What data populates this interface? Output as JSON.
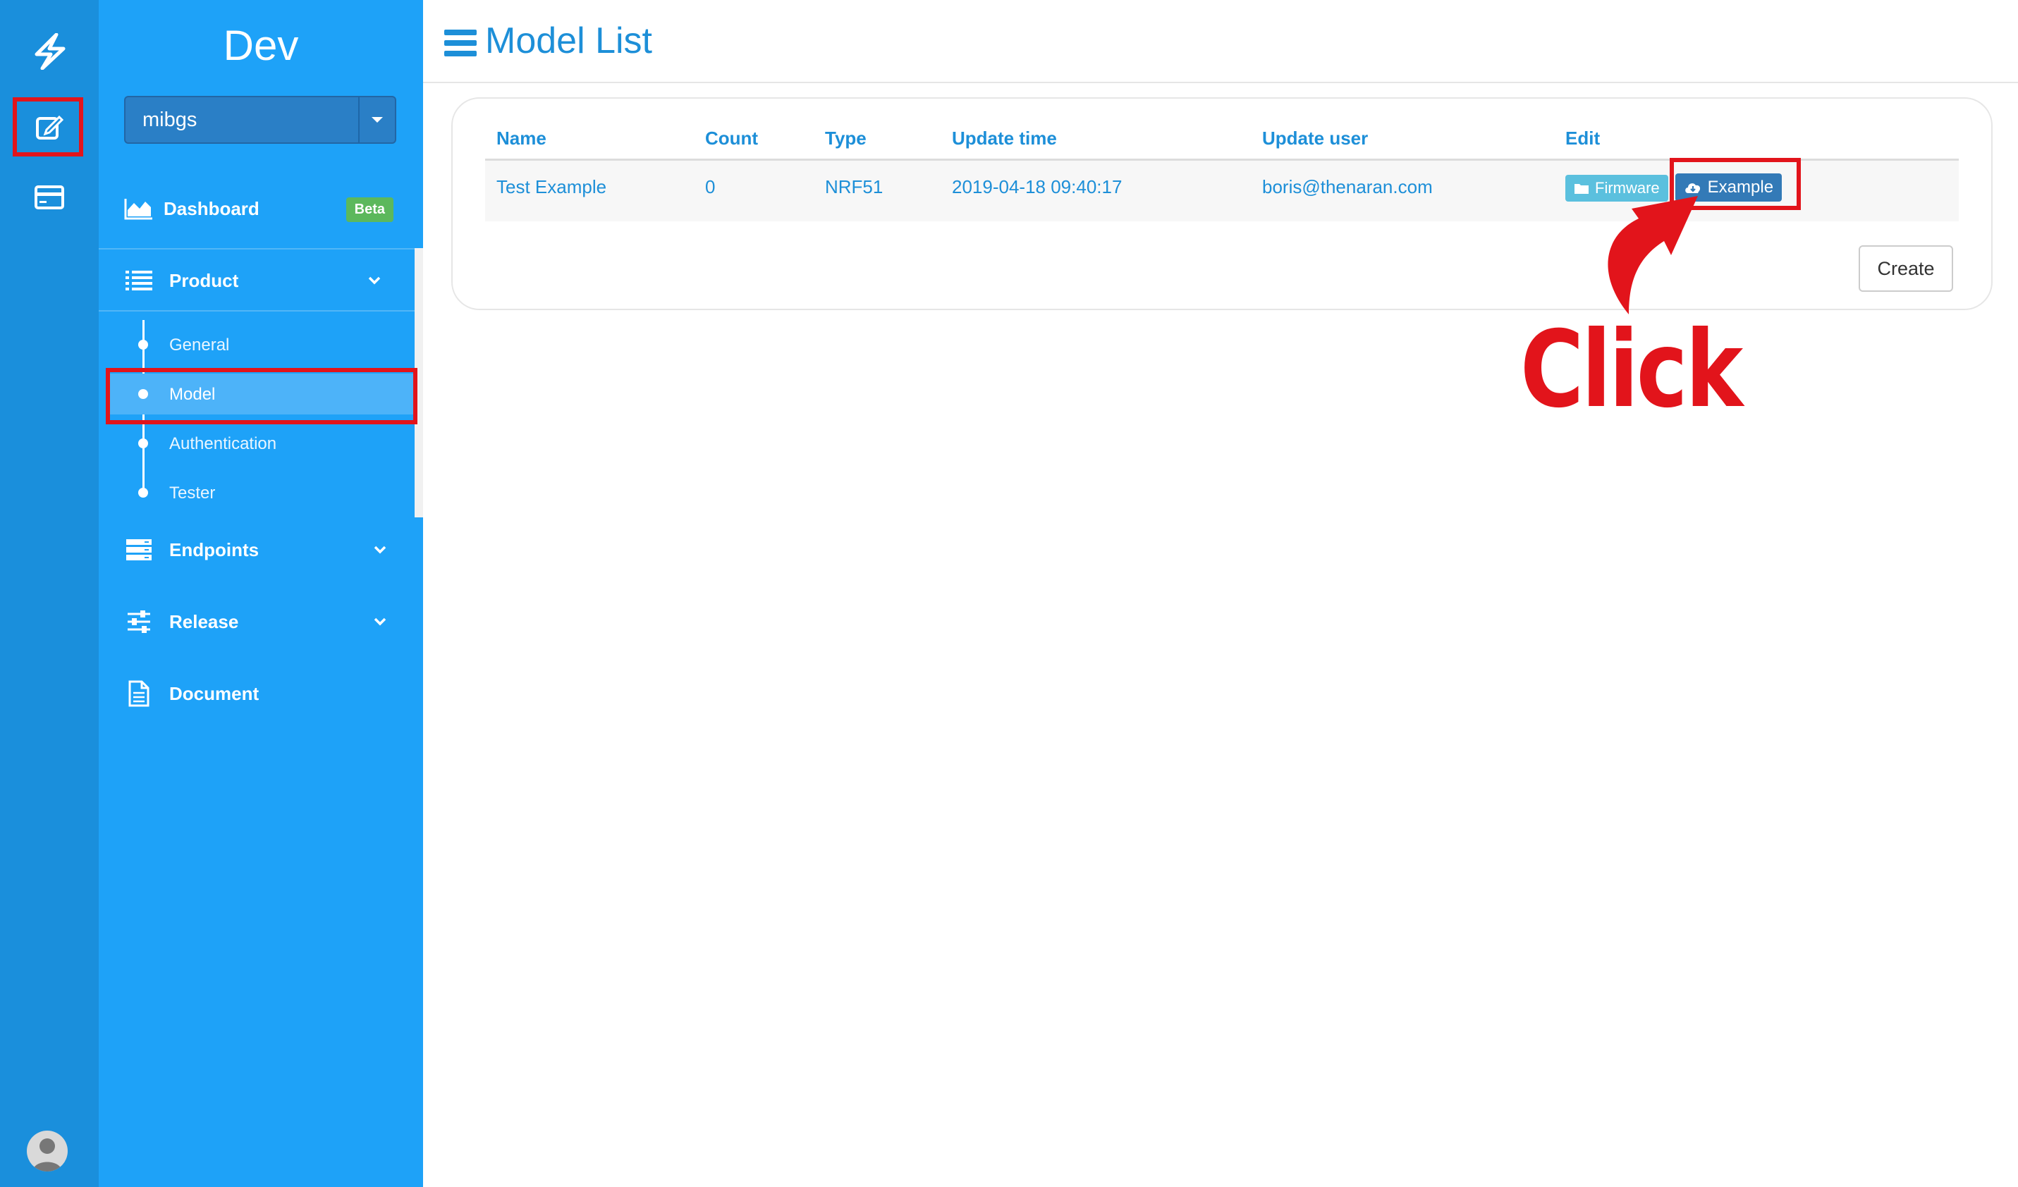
{
  "sidebar": {
    "title": "Dev",
    "project": "mibgs",
    "items": [
      {
        "label": "Dashboard",
        "badge": "Beta"
      },
      {
        "label": "Product"
      },
      {
        "label": "Endpoints"
      },
      {
        "label": "Release"
      },
      {
        "label": "Document"
      }
    ],
    "product_sub": [
      {
        "label": "General"
      },
      {
        "label": "Model"
      },
      {
        "label": "Authentication"
      },
      {
        "label": "Tester"
      }
    ]
  },
  "header": {
    "title": "Model List"
  },
  "table": {
    "columns": [
      "Name",
      "Count",
      "Type",
      "Update time",
      "Update user",
      "Edit"
    ],
    "rows": [
      {
        "name": "Test Example",
        "count": "0",
        "type": "NRF51",
        "update_time": "2019-04-18 09:40:17",
        "update_user": "boris@thenaran.com",
        "firmware_label": "Firmware",
        "example_label": "Example"
      }
    ]
  },
  "create_label": "Create",
  "annotation": {
    "text": "Click"
  },
  "colors": {
    "sidebar": "#1ea2f8",
    "rail": "#1a8fdc",
    "accent": "#1d8fd8",
    "highlight": "#e2141b"
  }
}
